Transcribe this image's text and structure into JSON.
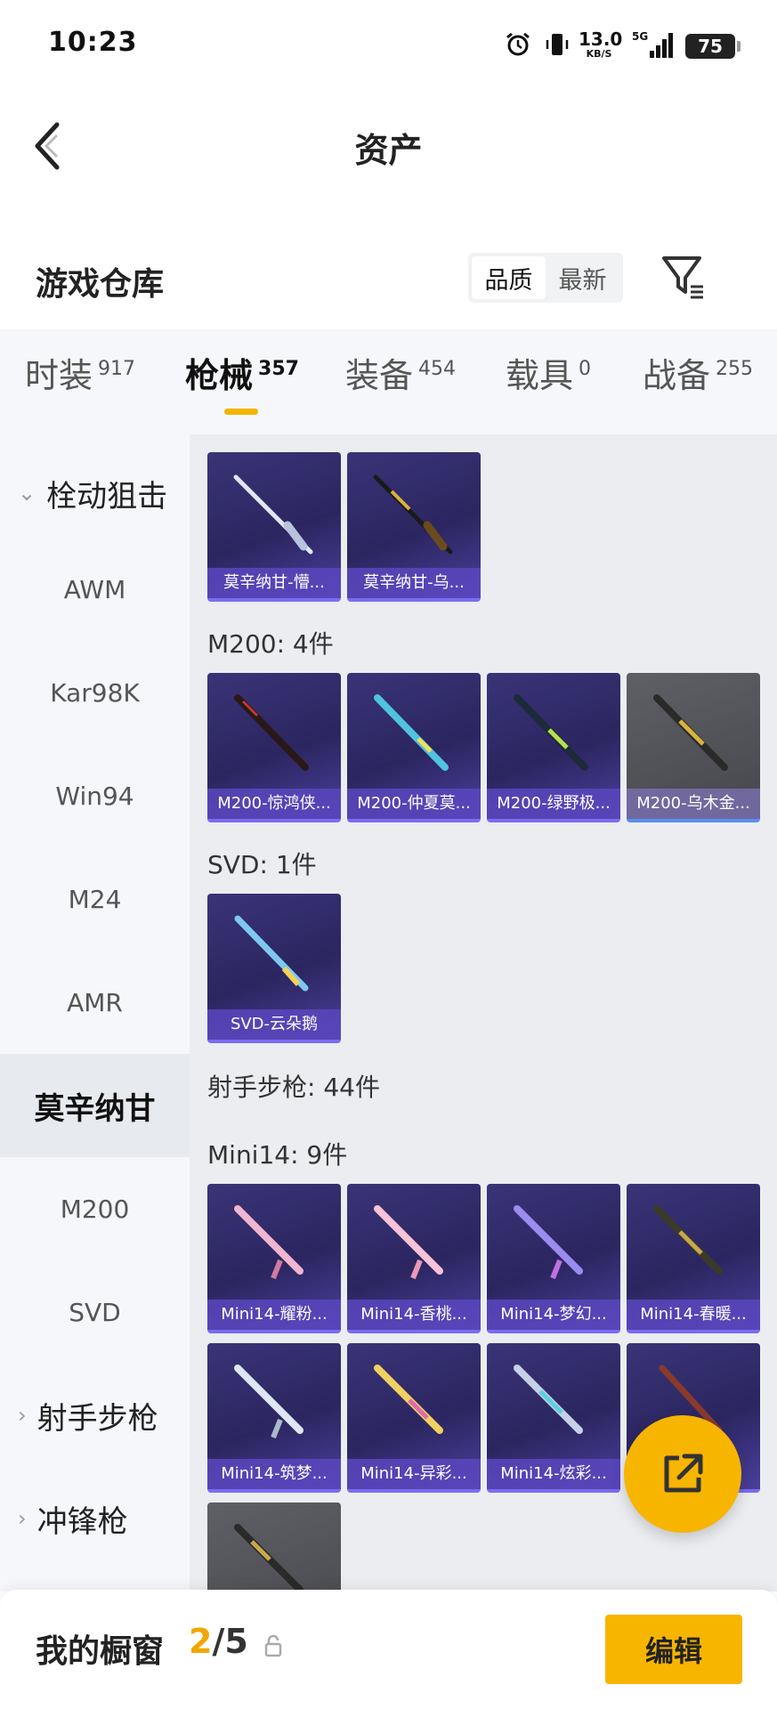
{
  "status_bar": {
    "time": "10:23",
    "net_speed": "13.0",
    "net_unit": "KB/S",
    "network": "5G",
    "battery": "75"
  },
  "header": {
    "title": "资产"
  },
  "section": {
    "title": "游戏仓库",
    "sort_options": [
      "品质",
      "最新"
    ],
    "sort_selected": "品质"
  },
  "tabs": [
    {
      "label": "时装",
      "count": "917"
    },
    {
      "label": "枪械",
      "count": "357"
    },
    {
      "label": "装备",
      "count": "454"
    },
    {
      "label": "载具",
      "count": "0"
    },
    {
      "label": "战备",
      "count": "255"
    }
  ],
  "sidebar": {
    "items": [
      {
        "label": "栓动狙击",
        "type": "group-expanded"
      },
      {
        "label": "AWM"
      },
      {
        "label": "Kar98K"
      },
      {
        "label": "Win94"
      },
      {
        "label": "M24"
      },
      {
        "label": "AMR"
      },
      {
        "label": "莫辛纳甘",
        "selected": true
      },
      {
        "label": "M200"
      },
      {
        "label": "SVD"
      },
      {
        "label": "射手步枪",
        "type": "group-collapsed"
      },
      {
        "label": "冲锋枪",
        "type": "group-collapsed"
      }
    ]
  },
  "content": {
    "groups": [
      {
        "header": "",
        "items": [
          "莫辛纳甘-懵...",
          "莫辛纳甘-乌..."
        ]
      },
      {
        "header": "M200: 4件",
        "items": [
          "M200-惊鸿侠...",
          "M200-仲夏莫...",
          "M200-绿野极...",
          "M200-乌木金..."
        ]
      },
      {
        "header": "SVD: 1件",
        "items": [
          "SVD-云朵鹅"
        ]
      },
      {
        "header": "射手步枪: 44件",
        "items": []
      },
      {
        "header": "Mini14: 9件",
        "items": [
          "Mini14-耀粉...",
          "Mini14-香桃...",
          "Mini14-梦幻...",
          "Mini14-春暖...",
          "Mini14-筑梦...",
          "Mini14-异彩...",
          "Mini14-炫彩..."
        ]
      }
    ]
  },
  "bottom_bar": {
    "label": "我的橱窗",
    "showcase_count": "2",
    "showcase_total": "/5",
    "edit_label": "编辑"
  },
  "colors": {
    "accent": "#f7b500",
    "card_purple": "#2b2660",
    "card_caption": "#5a46be"
  }
}
